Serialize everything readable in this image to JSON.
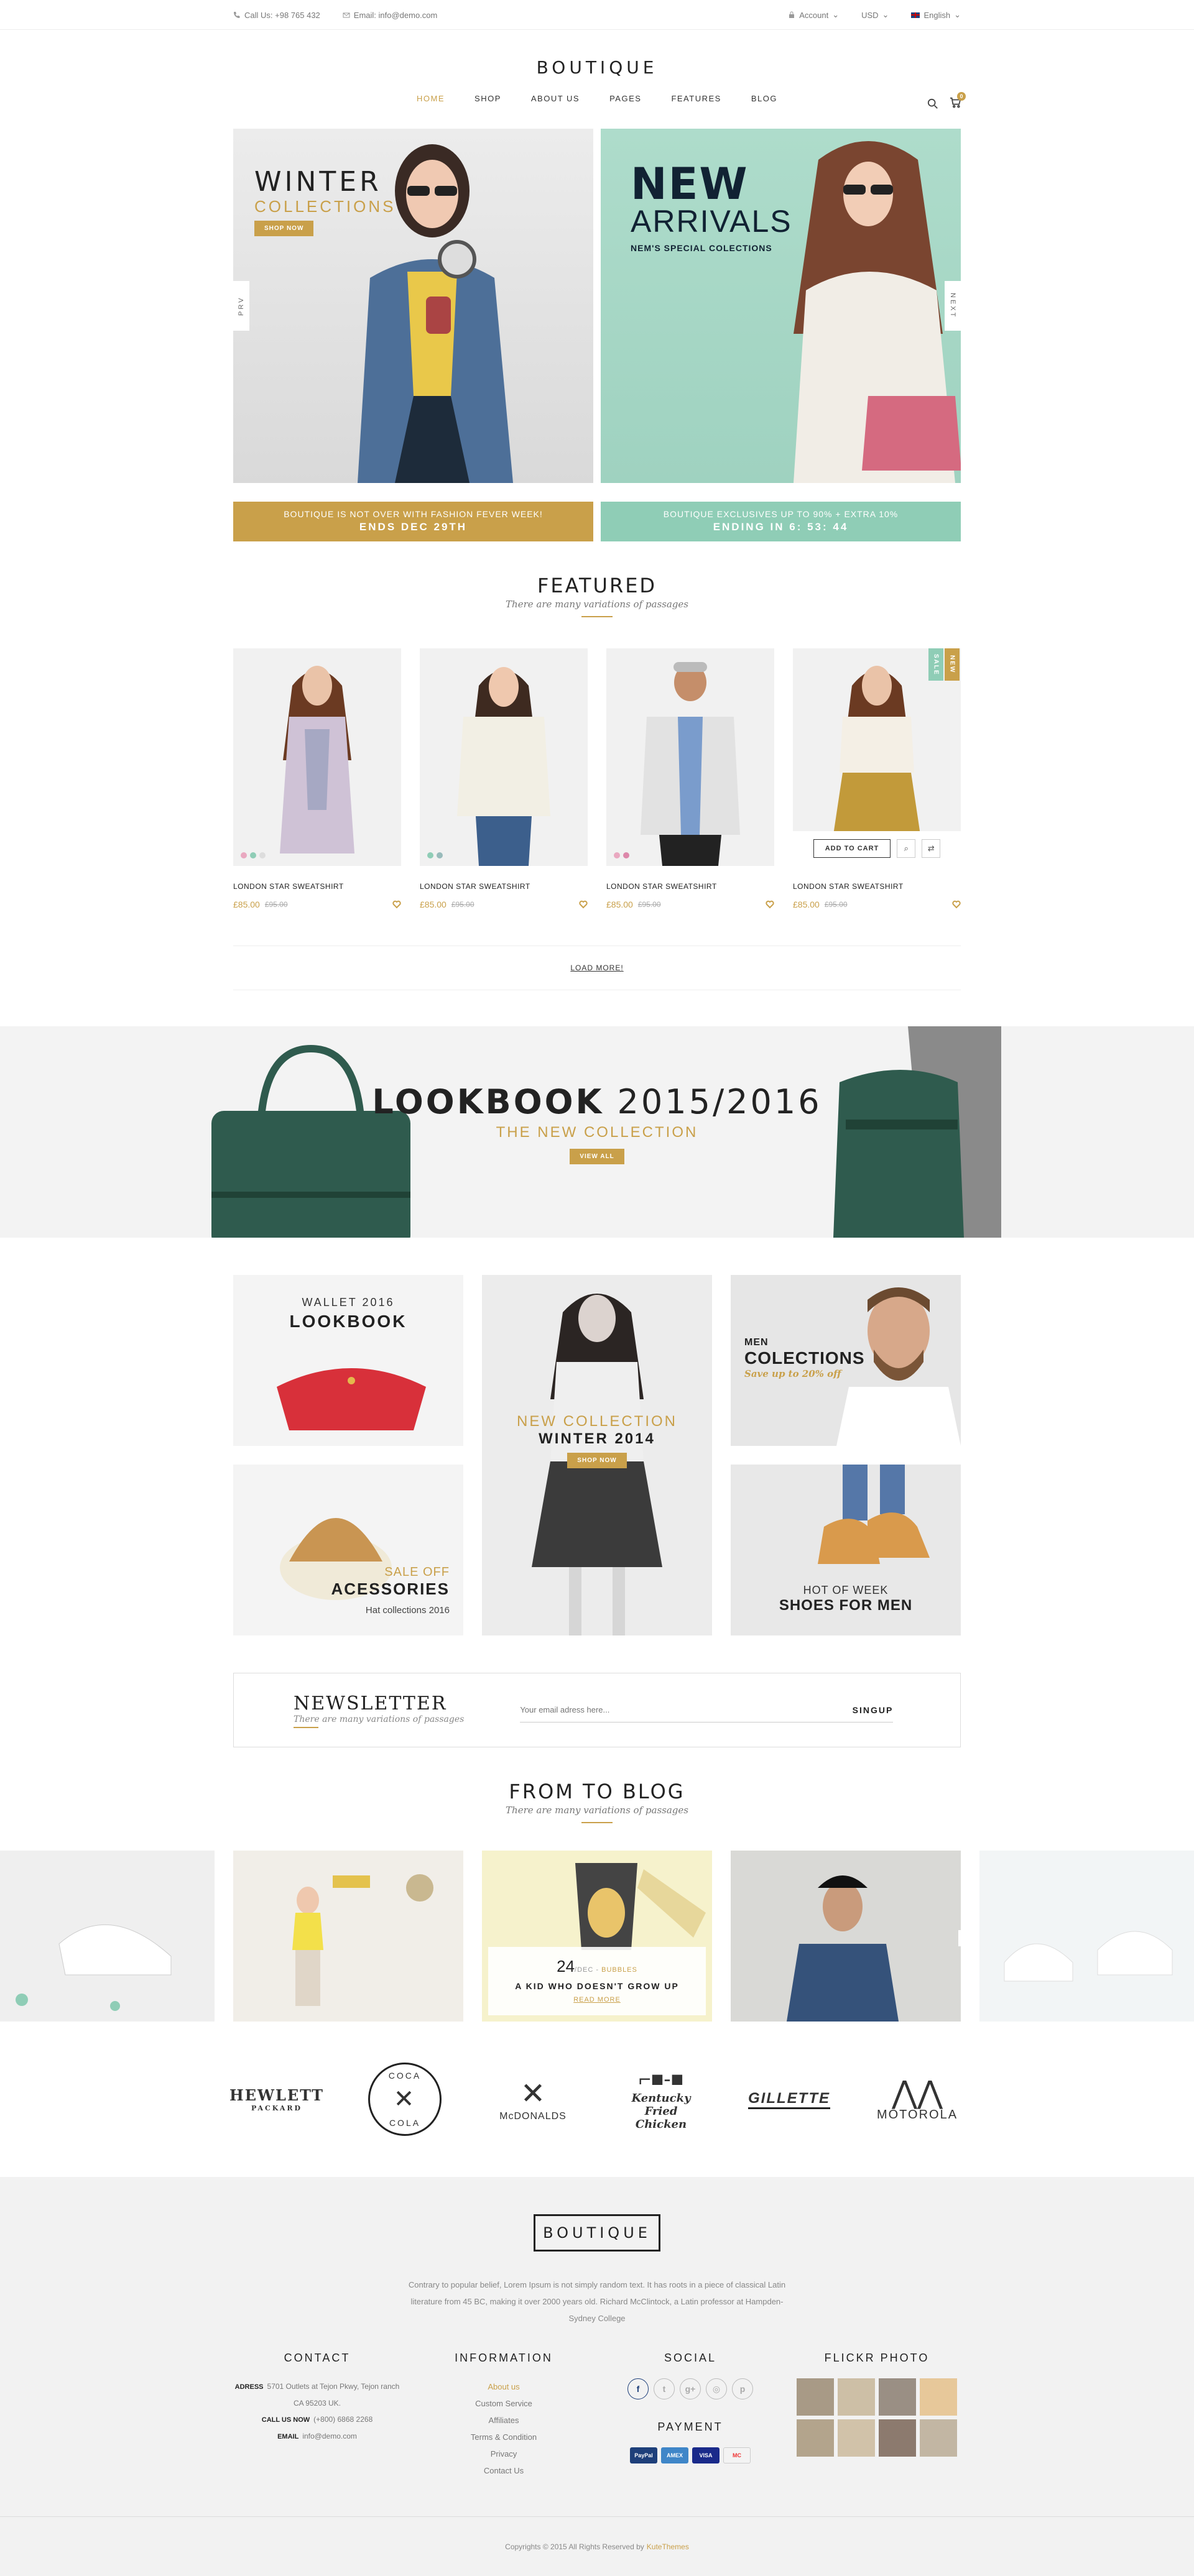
{
  "topbar": {
    "phone": "Call Us: +98 765 432",
    "email": "Email: info@demo.com",
    "account": "Account",
    "currency": "USD",
    "language": "English"
  },
  "header": {
    "logo": "BOUTIQUE",
    "cart_count": "0"
  },
  "nav": [
    "HOME",
    "SHOP",
    "ABOUT US",
    "PAGES",
    "FEATURES",
    "BLOG"
  ],
  "hero": {
    "s1_title": "WINTER",
    "s1_sub": "COLLECTIONS",
    "s1_btn": "SHOP NOW",
    "s2_title": "NEW",
    "s2_sub": "ARRIVALS",
    "s2_tag": "NEM'S SPECIAL COLECTIONS",
    "prev": "PRV",
    "next": "NEXT"
  },
  "promos": [
    {
      "text": "BOUTIQUE IS NOT OVER WITH FASHION FEVER WEEK!",
      "bold": "ENDS DEC 29TH"
    },
    {
      "text": "BOUTIQUE EXCLUSIVES UP TO 90% + EXTRA 10%",
      "bold": "ENDING IN 6: 53: 44"
    }
  ],
  "featured": {
    "title": "FEATURED",
    "subtitle": "There are many variations of passages"
  },
  "products": [
    {
      "name": "LONDON STAR SWEATSHIRT",
      "price": "£85.00",
      "old": "£95.00"
    },
    {
      "name": "LONDON STAR SWEATSHIRT",
      "price": "£85.00",
      "old": "£95.00"
    },
    {
      "name": "LONDON STAR SWEATSHIRT",
      "price": "£85.00",
      "old": "£95.00"
    },
    {
      "name": "LONDON STAR SWEATSHIRT",
      "price": "£85.00",
      "old": "£95.00",
      "sale": "SALE",
      "new": "NEW",
      "add": "ADD TO CART"
    }
  ],
  "load_more": "LOAD MORE!",
  "lookbook": {
    "title": "LOOKBOOK",
    "year": "2015/2016",
    "sub": "THE NEW COLLECTION",
    "btn": "VIEW ALL"
  },
  "grid": {
    "wallet_small": "WALLET 2016",
    "wallet_big": "LOOKBOOK",
    "newcol_small": "NEW COLLECTION",
    "newcol_big": "WINTER 2014",
    "newcol_btn": "SHOP NOW",
    "men_small": "MEN",
    "men_big": "COLECTIONS",
    "men_sub": "Save up to 20% off",
    "acc_small": "SALE OFF",
    "acc_big": "ACESSORIES",
    "acc_sub": "Hat collections 2016",
    "shoes_small": "HOT OF WEEK",
    "shoes_big": "SHOES FOR MEN"
  },
  "newsletter": {
    "title": "NEWSLETTER",
    "subtitle": "There are many variations of passages",
    "placeholder": "Your email adress here...",
    "btn": "SINGUP"
  },
  "blog": {
    "title": "FROM TO BLOG",
    "subtitle": "There are many variations of passages",
    "day": "24",
    "date": "/DEC - ",
    "author": "BUBBLES",
    "post_title": "A KID WHO DOESN'T GROW UP",
    "read": "READ MORE"
  },
  "brands": [
    "HEWLETT",
    "PACKARD",
    "COCA",
    "COLA",
    "McDONALDS",
    "Kentucky",
    "Fried Chicken",
    "GILLETTE",
    "MOTOROLA"
  ],
  "footer": {
    "logo": "BOUTIQUE",
    "desc": "Contrary to popular belief, Lorem Ipsum is not simply random text. It has roots in a piece of classical Latin literature from 45 BC, making it over 2000 years old. Richard McClintock, a Latin professor at Hampden-Sydney College",
    "contact_title": "CONTACT",
    "address_label": "ADRESS",
    "address": "5701 Outlets at Tejon Pkwy, Tejon ranch CA 95203 UK.",
    "call_label": "CALL US NOW",
    "call": "(+800) 6868 2268",
    "email_label": "EMAIL",
    "email": "info@demo.com",
    "info_title": "INFORMATION",
    "info_links": [
      "About us",
      "Custom Service",
      "Affiliates",
      "Terms & Condition",
      "Privacy",
      "Contact Us"
    ],
    "social_title": "SOCIAL",
    "payment_title": "PAYMENT",
    "flickr_title": "FLICKR PHOTO",
    "social": [
      "f",
      "t",
      "g+",
      "◎",
      "p"
    ],
    "payments": [
      "PayPal",
      "AMEX",
      "VISA",
      "MC"
    ],
    "copyright": "Copyrights © 2015 All Rights Reserved by",
    "company": "KuteThemes"
  }
}
